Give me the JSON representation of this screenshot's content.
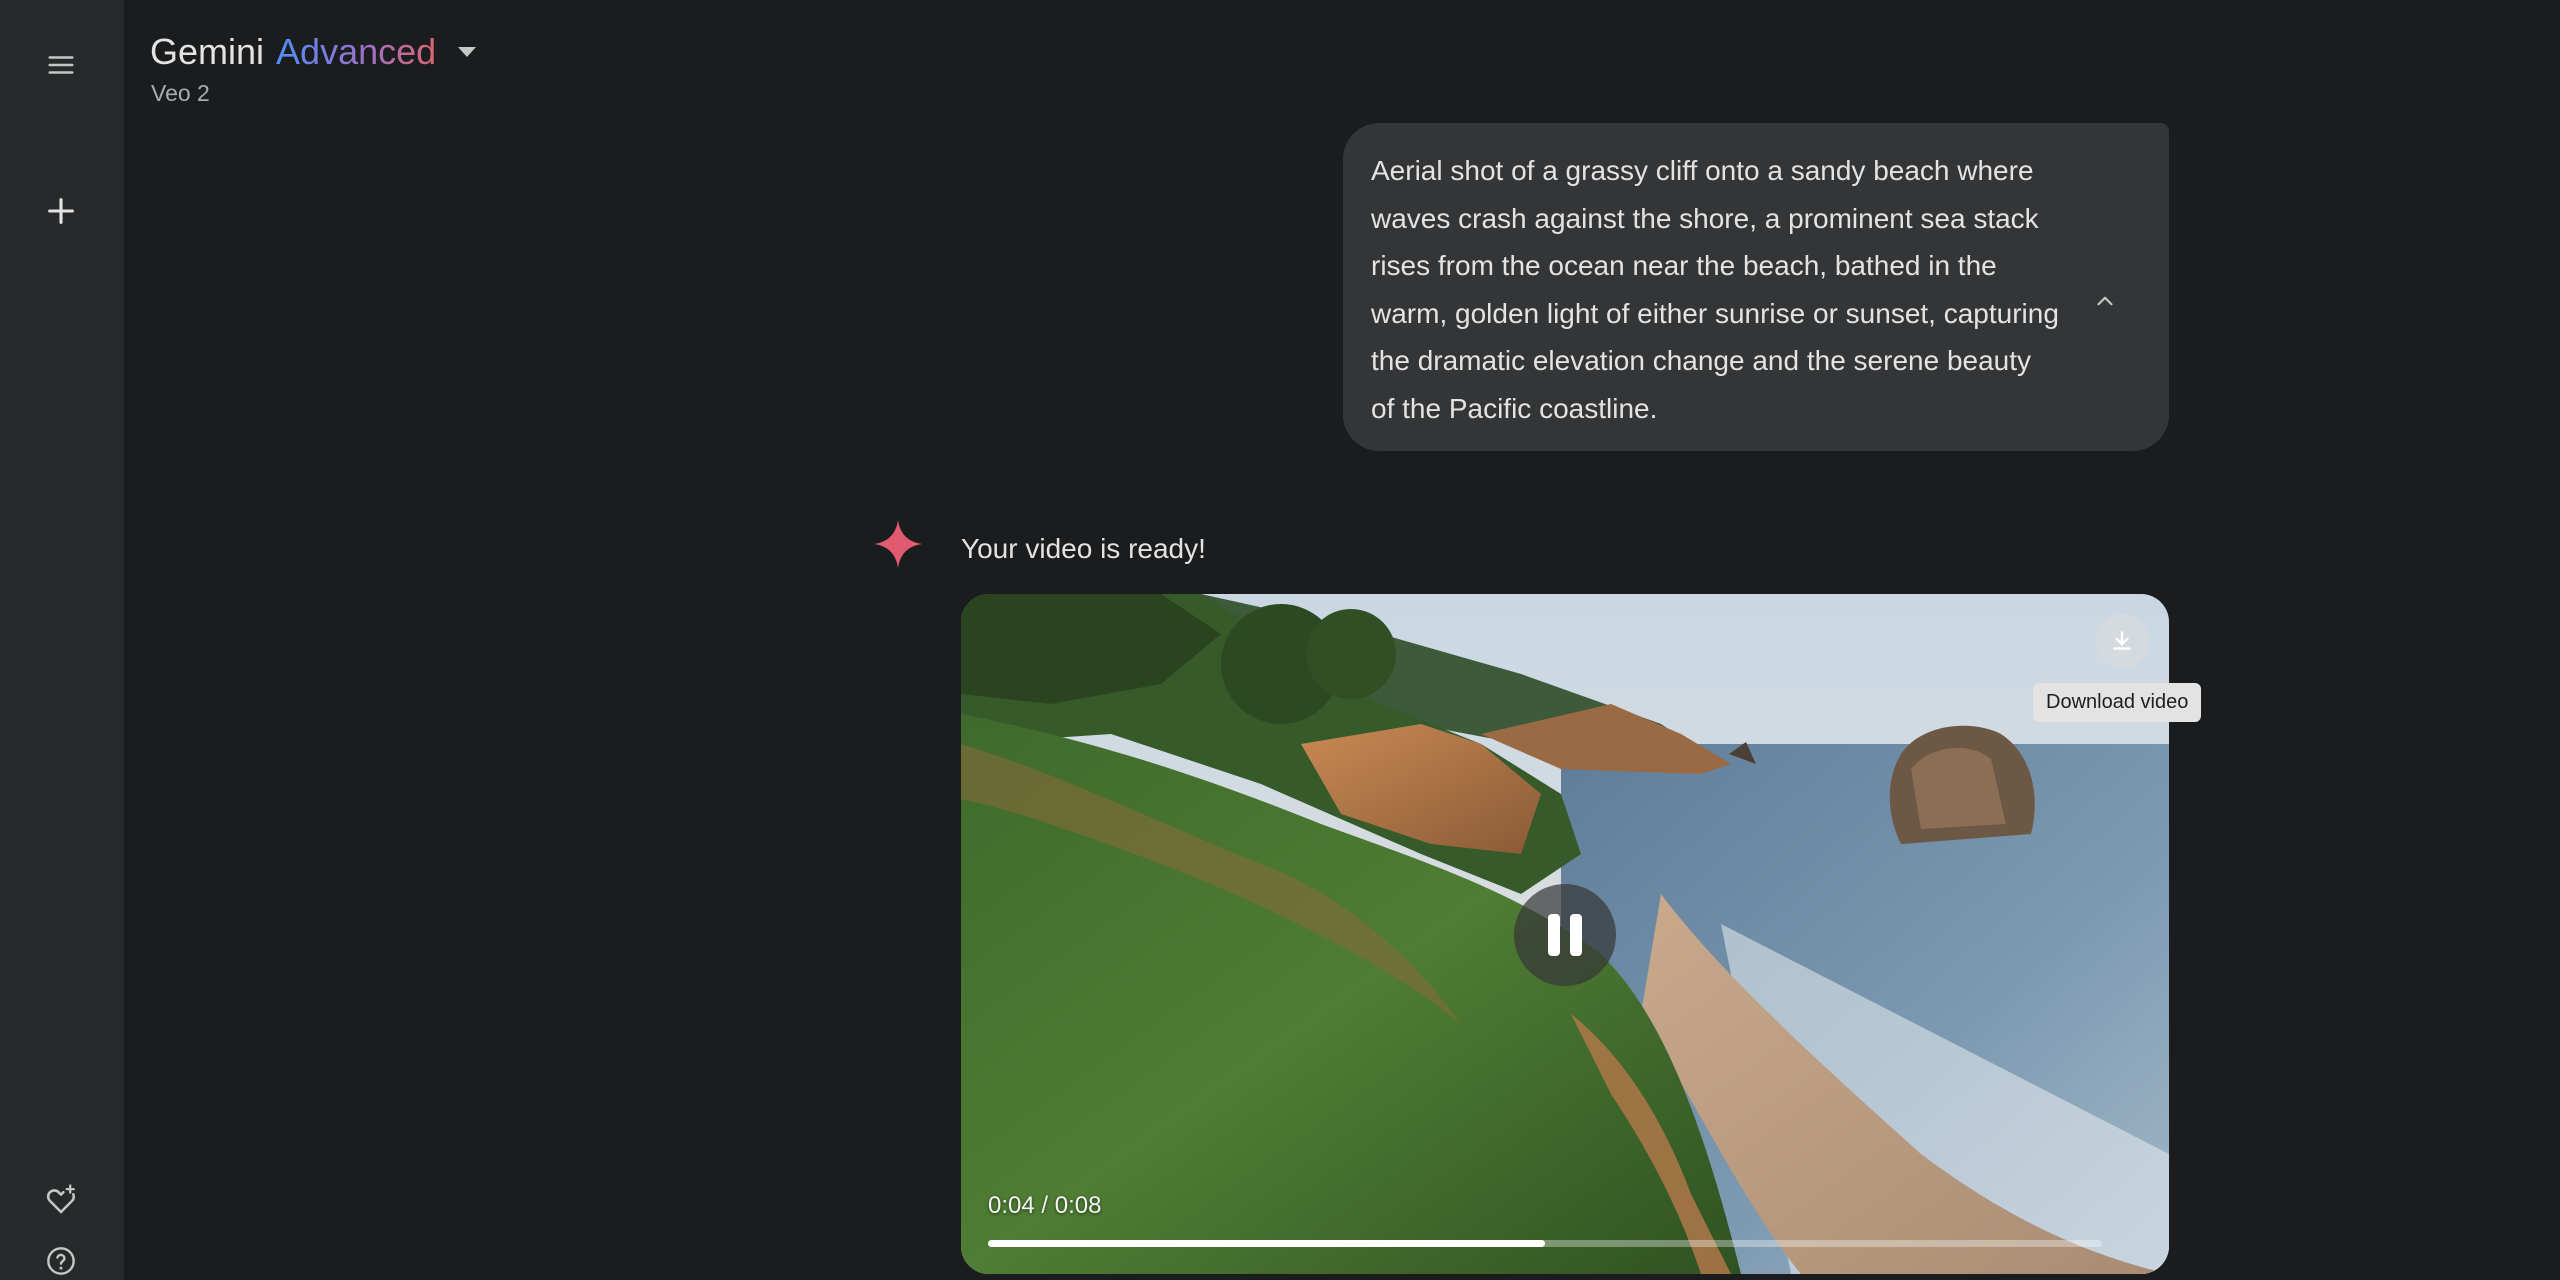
{
  "header": {
    "brand_name": "Gemini",
    "brand_tier": "Advanced",
    "model_name": "Veo 2"
  },
  "sidebar": {
    "icons": [
      "menu-icon",
      "plus-icon",
      "gem-icon",
      "help-icon"
    ]
  },
  "conversation": {
    "prompt": "Aerial shot of a grassy cliff onto a sandy beach where waves crash against the shore, a prominent sea stack rises from the ocean near the beach, bathed in the warm, golden light of either sunrise or sunset, capturing the dramatic elevation change and the serene beauty of the Pacific coastline.",
    "response": "Your video is ready!"
  },
  "video": {
    "time_display": "0:04 / 0:08",
    "current_seconds": 4,
    "duration_seconds": 8,
    "progress_fraction": 0.5,
    "download_tooltip": "Download video"
  },
  "colors": {
    "background": "#1b1c1d",
    "sidebar": "#28292a",
    "bubble": "#333537",
    "spark": "#e15a6f",
    "advanced_gradient_start": "#4f8ef7",
    "advanced_gradient_end": "#d96570"
  }
}
